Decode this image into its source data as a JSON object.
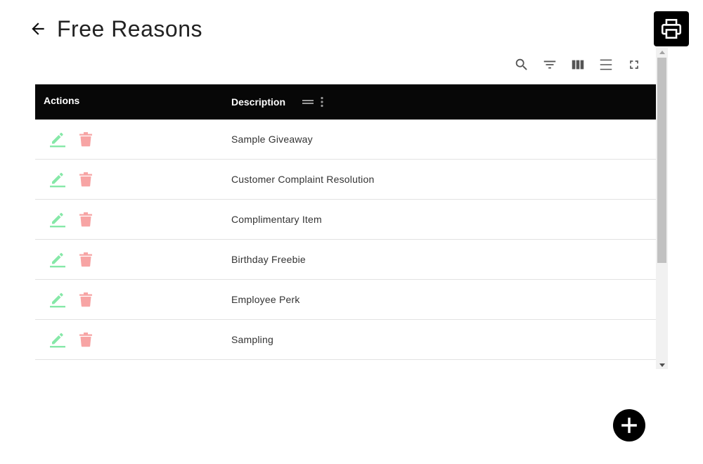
{
  "header": {
    "title": "Free Reasons",
    "back_icon": "arrow-left-icon",
    "print_icon": "printer-icon"
  },
  "toolbar": {
    "icons": [
      "search-icon",
      "filter-icon",
      "columns-icon",
      "density-icon",
      "fullscreen-icon"
    ]
  },
  "table": {
    "columns": {
      "actions": "Actions",
      "description": "Description"
    },
    "rows": [
      {
        "description": "Sample Giveaway"
      },
      {
        "description": "Customer Complaint Resolution"
      },
      {
        "description": "Complimentary Item"
      },
      {
        "description": "Birthday Freebie"
      },
      {
        "description": "Employee Perk"
      },
      {
        "description": "Sampling"
      }
    ]
  },
  "fab": {
    "icon": "plus-icon"
  },
  "colors": {
    "edit": "#86e8a8",
    "delete": "#f7a4a4",
    "header_bg": "#070707"
  }
}
